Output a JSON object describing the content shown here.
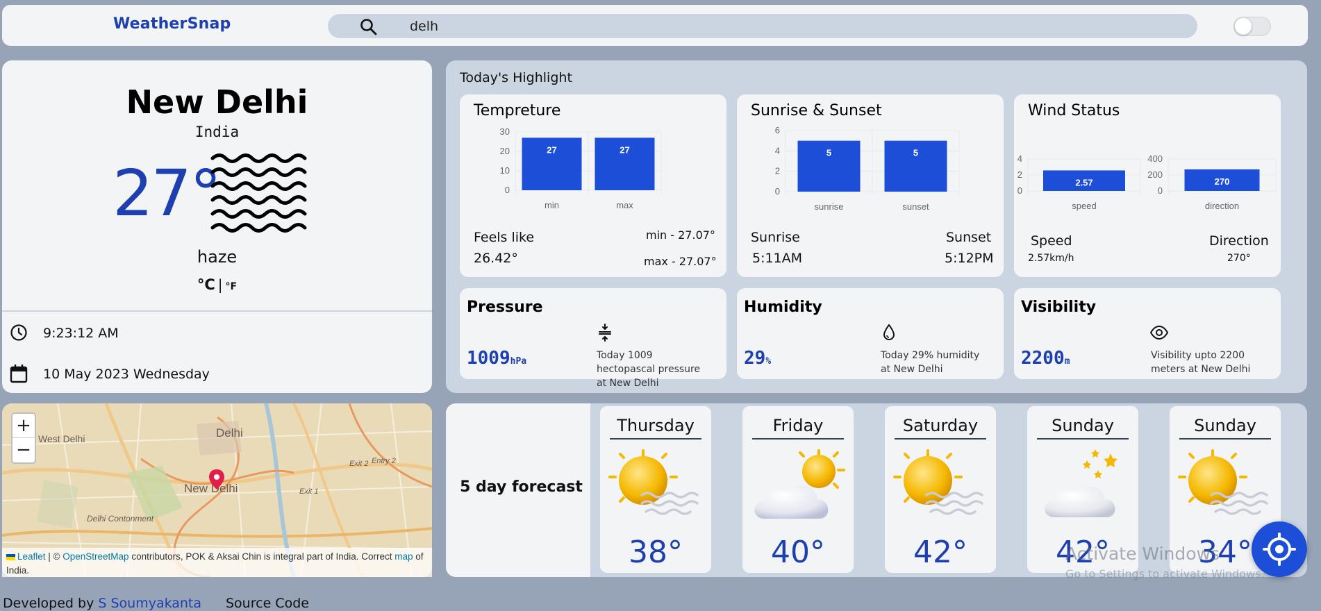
{
  "header": {
    "brand": "WeatherSnap",
    "search_value": "delh",
    "search_icon": "search-icon",
    "theme_toggle": "off"
  },
  "current": {
    "city": "New Delhi",
    "country": "India",
    "temperature": "27°",
    "condition": "haze",
    "condition_icon": "haze-icon",
    "unit_c": "°C",
    "unit_sep": "|",
    "unit_f": "°F",
    "time": "9:23:12 AM",
    "date": "10 May 2023 Wednesday"
  },
  "map": {
    "zoom_in": "+",
    "zoom_out": "−",
    "labels": [
      "Delhi",
      "West Delhi",
      "New Delhi",
      "Delhi Cantonment",
      "Exit 2",
      "Entry 2",
      "Exit 1"
    ],
    "attribution": {
      "leaflet": "Leaflet",
      "sep": " | © ",
      "osm": "OpenStreetMap",
      "rest": " contributors, POK & Aksai Chin is integral part of India. Correct ",
      "map_link": "map",
      "end": " of India."
    }
  },
  "highlights": {
    "title": "Today's Highlight",
    "temperature": {
      "title": "Tempreture",
      "feels_like_label": "Feels like",
      "feels_like_value": "26.42°",
      "min": "min - 27.07°",
      "max": "max - 27.07°"
    },
    "sun": {
      "title": "Sunrise & Sunset",
      "sunrise_label": "Sunrise",
      "sunrise_value": "5:11AM",
      "sunset_label": "Sunset",
      "sunset_value": "5:12PM"
    },
    "wind": {
      "title": "Wind Status",
      "speed_label": "Speed",
      "speed_value": "2.57km/h",
      "direction_label": "Direction",
      "direction_value": "270°"
    },
    "pressure": {
      "title": "Pressure",
      "value": "1009",
      "unit": "hPa",
      "icon": "compress-icon",
      "desc": "Today 1009 hectopascal pressure at New Delhi"
    },
    "humidity": {
      "title": "Humidity",
      "value": "29",
      "unit": "%",
      "icon": "droplet-icon",
      "desc": "Today 29% humidity at New Delhi"
    },
    "visibility": {
      "title": "Visibility",
      "value": "2200",
      "unit": "m",
      "icon": "eye-icon",
      "desc": "Visibility upto 2200 meters at New Delhi"
    }
  },
  "chart_data": [
    {
      "type": "bar",
      "categories": [
        "min",
        "max"
      ],
      "values": [
        27,
        27
      ],
      "ylim": [
        0,
        30
      ],
      "yticks": [
        0,
        10,
        20,
        30
      ],
      "bar_color": "#1d4ed8"
    },
    {
      "type": "bar",
      "categories": [
        "sunrise",
        "sunset"
      ],
      "values": [
        5,
        5
      ],
      "ylim": [
        0,
        6
      ],
      "yticks": [
        0,
        2,
        4,
        6
      ],
      "bar_color": "#1d4ed8"
    },
    {
      "type": "bar",
      "categories": [
        "speed"
      ],
      "values": [
        2.57
      ],
      "ylim": [
        0,
        4
      ],
      "yticks": [
        0,
        2,
        4
      ],
      "bar_color": "#1d4ed8"
    },
    {
      "type": "bar",
      "categories": [
        "direction"
      ],
      "values": [
        270
      ],
      "ylim": [
        0,
        400
      ],
      "yticks": [
        0,
        200,
        400
      ],
      "bar_color": "#1d4ed8"
    }
  ],
  "forecast": {
    "title": "5 day forecast",
    "days": [
      {
        "day": "Thursday",
        "temp": "38°",
        "icon": "sun-haze-icon"
      },
      {
        "day": "Friday",
        "temp": "40°",
        "icon": "sun-cloud-icon"
      },
      {
        "day": "Saturday",
        "temp": "42°",
        "icon": "sun-haze-icon"
      },
      {
        "day": "Sunday",
        "temp": "42°",
        "icon": "cloud-stars-icon"
      },
      {
        "day": "Sunday",
        "temp": "34°",
        "icon": "sun-haze-icon"
      }
    ]
  },
  "overlay": {
    "activate_title": "Activate Windows",
    "activate_sub": "Go to Settings to activate Windows."
  },
  "locate_button_icon": "crosshair-icon",
  "footer": {
    "developed_by": "Developed by ",
    "author": "S Soumyakanta",
    "source": "Source Code"
  },
  "colors": {
    "accent": "#1e40af",
    "bar": "#1d4ed8",
    "background": "#97a3b7",
    "panel": "#cbd5e1",
    "card": "#f3f4f6"
  }
}
